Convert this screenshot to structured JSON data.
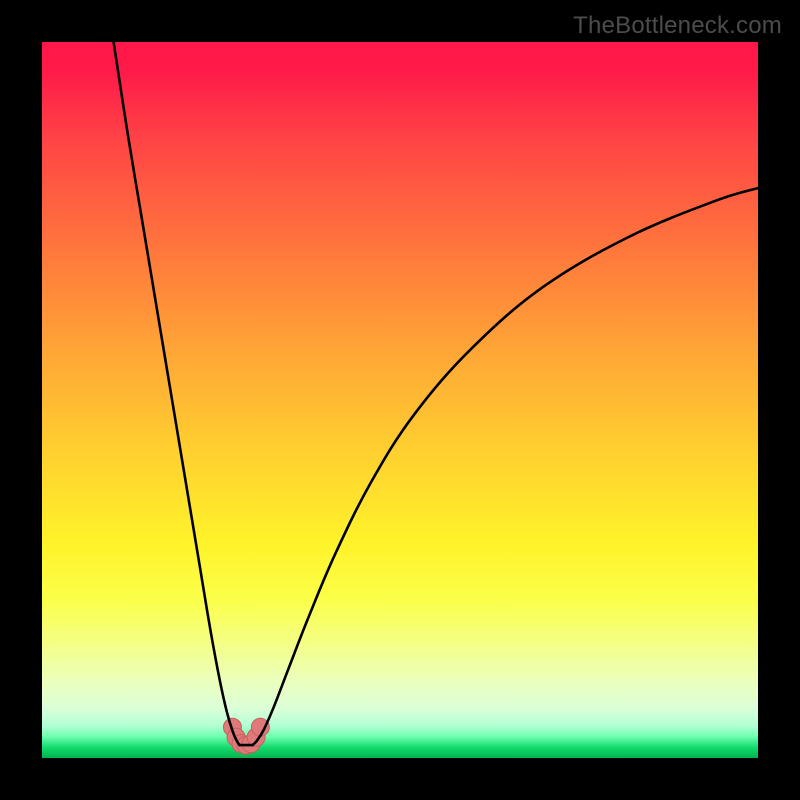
{
  "watermark": "TheBottleneck.com",
  "colors": {
    "frame": "#000000",
    "curve_stroke": "#000000",
    "marker_fill": "#e07a7a",
    "marker_stroke": "#c95e5e"
  },
  "chart_data": {
    "type": "line",
    "title": "",
    "xlabel": "",
    "ylabel": "",
    "xlim": [
      0,
      100
    ],
    "ylim": [
      0,
      100
    ],
    "grid": false,
    "series": [
      {
        "name": "left-branch",
        "x": [
          10,
          12,
          14,
          16,
          18,
          20,
          22,
          23.5,
          24.8,
          25.8,
          26.6,
          27.2,
          27.6
        ],
        "y": [
          100,
          87,
          75,
          63,
          51,
          39,
          27,
          18,
          11,
          6.5,
          3.8,
          2.4,
          1.8
        ]
      },
      {
        "name": "right-branch",
        "x": [
          29.4,
          30.0,
          31.0,
          32.4,
          34.4,
          37.2,
          41.0,
          46.0,
          52.0,
          60.0,
          70.0,
          82.0,
          94.0,
          100.0
        ],
        "y": [
          1.8,
          2.4,
          4.0,
          7.2,
          12.4,
          19.6,
          28.6,
          38.6,
          48.0,
          57.2,
          65.8,
          72.8,
          77.8,
          79.6
        ]
      }
    ],
    "flat_bottom": {
      "x_start": 27.6,
      "x_end": 29.4,
      "y": 1.8
    },
    "markers": {
      "name": "highlight-cluster",
      "points": [
        {
          "x": 26.6,
          "y": 4.3
        },
        {
          "x": 27.1,
          "y": 2.9
        },
        {
          "x": 27.8,
          "y": 2.0
        },
        {
          "x": 28.5,
          "y": 1.8
        },
        {
          "x": 29.2,
          "y": 2.0
        },
        {
          "x": 29.9,
          "y": 2.9
        },
        {
          "x": 30.5,
          "y": 4.3
        }
      ],
      "radius_px": 9
    }
  }
}
